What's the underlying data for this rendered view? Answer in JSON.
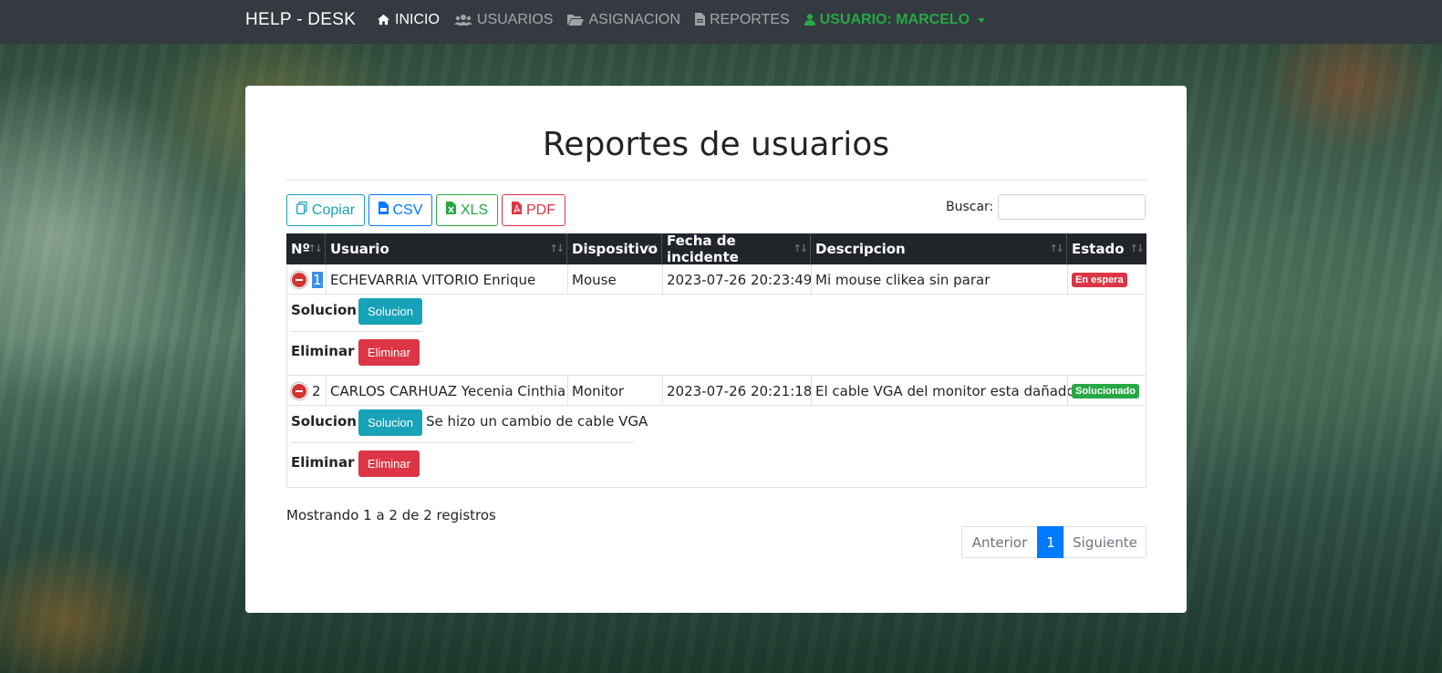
{
  "nav": {
    "brand": "HELP - DESK",
    "items": [
      {
        "label": "INICIO",
        "icon": "home-icon"
      },
      {
        "label": "USUARIOS",
        "icon": "users-icon"
      },
      {
        "label": "ASIGNACION",
        "icon": "folder-open-icon"
      },
      {
        "label": "REPORTES",
        "icon": "file-icon"
      },
      {
        "label": "USUARIO: MARCELO",
        "icon": "user-icon"
      }
    ]
  },
  "page": {
    "title": "Reportes de usuarios"
  },
  "toolbar": {
    "copy_label": "Copiar",
    "csv_label": "CSV",
    "xls_label": "XLS",
    "pdf_label": "PDF",
    "search_label": "Buscar:",
    "search_value": ""
  },
  "table": {
    "headers": [
      "Nº",
      "Usuario",
      "Dispositivo",
      "Fecha de incidente",
      "Descripcion",
      "Estado"
    ],
    "rows": [
      {
        "num": "1",
        "usuario": "ECHEVARRIA VITORIO Enrique",
        "dispositivo": "Mouse",
        "fecha": "2023-07-26 20:23:49",
        "descripcion": "Mi mouse clikea sin parar",
        "estado": "En espera",
        "estado_color": "#dc3545",
        "solucion_label": "Solucion",
        "solucion_btn": "Solucion",
        "solucion_text": "",
        "eliminar_label": "Eliminar",
        "eliminar_btn": "Eliminar"
      },
      {
        "num": "2",
        "usuario": "CARLOS CARHUAZ Yecenia Cinthia",
        "dispositivo": "Monitor",
        "fecha": "2023-07-26 20:21:18",
        "descripcion": "El cable VGA del monitor esta dañado",
        "estado": "Solucionado",
        "estado_color": "#28a745",
        "solucion_label": "Solucion",
        "solucion_btn": "Solucion",
        "solucion_text": "Se hizo un cambio de cable VGA",
        "eliminar_label": "Eliminar",
        "eliminar_btn": "Eliminar"
      }
    ]
  },
  "footer": {
    "info": "Mostrando 1 a 2 de 2 registros",
    "prev": "Anterior",
    "page": "1",
    "next": "Siguiente"
  }
}
